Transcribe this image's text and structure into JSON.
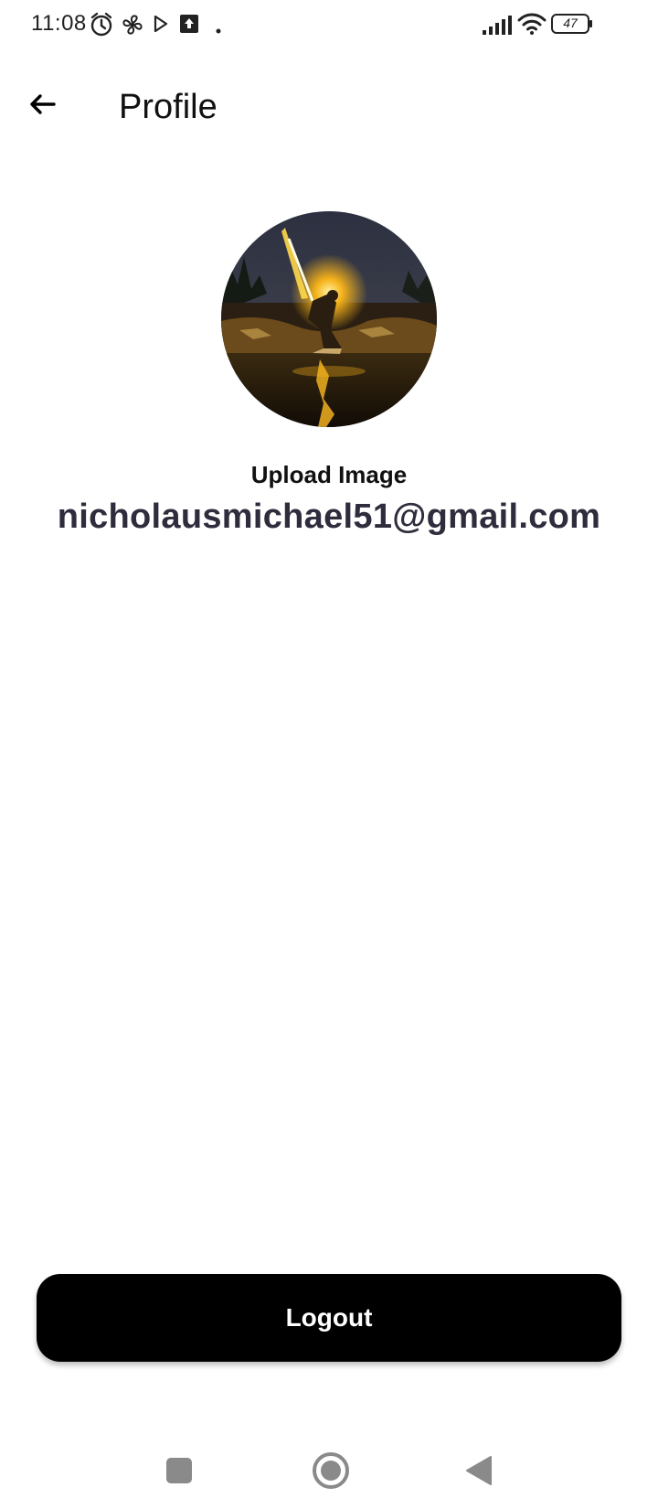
{
  "status_bar": {
    "time": "11:08",
    "battery_level": "47",
    "icons": [
      "alarm-icon",
      "fan-icon",
      "play-store-icon",
      "upload-icon",
      "dot-icon",
      "signal-icon",
      "wifi-icon",
      "battery-icon"
    ]
  },
  "app_bar": {
    "title": "Profile",
    "back_icon": "arrow-left-icon"
  },
  "profile": {
    "avatar_icon": "profile-photo",
    "upload_label": "Upload Image",
    "email": "nicholausmichael51@gmail.com"
  },
  "actions": {
    "logout_label": "Logout"
  },
  "nav_bar": {
    "items": [
      "recents-square-icon",
      "home-circle-icon",
      "back-triangle-icon"
    ]
  },
  "colors": {
    "background": "#ffffff",
    "button": "#000000",
    "email_text": "#2f2d3d",
    "avatar_glow": "#f5b21a"
  }
}
